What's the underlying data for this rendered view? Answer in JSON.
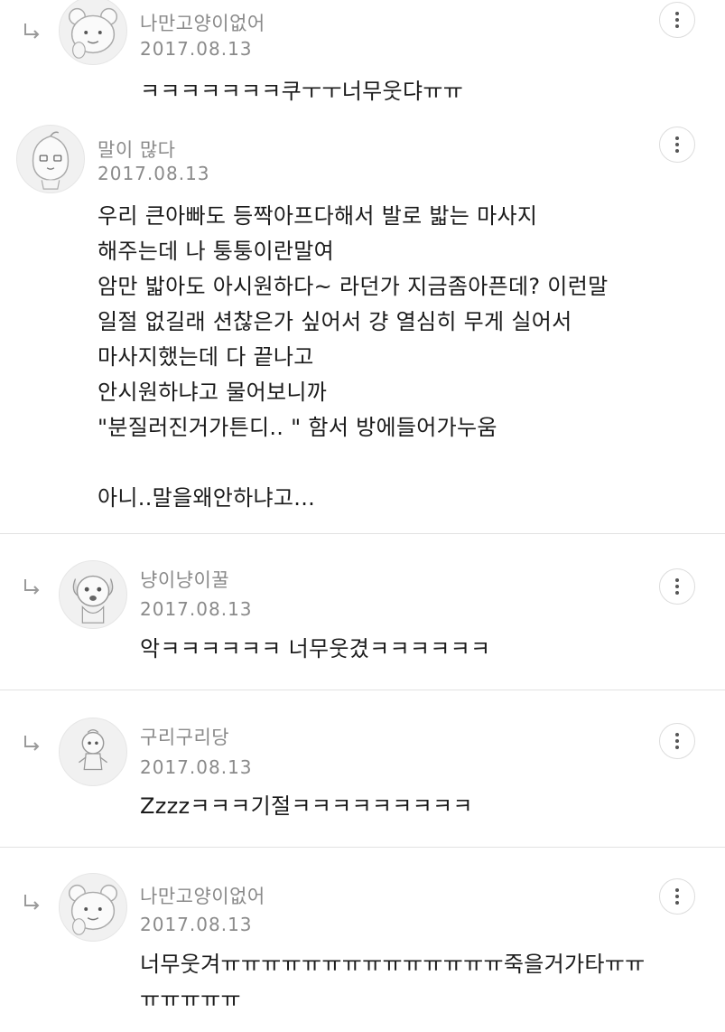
{
  "comments": [
    {
      "is_reply": true,
      "avatar_icon": "bear-character-avatar-icon",
      "nickname": "나만고양이없어",
      "date": "2017.08.13",
      "text": "ㅋㅋㅋㅋㅋㅋㅋ쿠ㅜㅜ너무웃댜ㅠㅠ"
    },
    {
      "is_reply": false,
      "avatar_icon": "peach-character-avatar-icon",
      "nickname": "말이 많다",
      "date": "2017.08.13",
      "text": "우리 큰아빠도 등짝아프다해서 발로 밟는 마사지\n해주는데 나 퉁퉁이란말여\n암만 밟아도 아시원하다~ 라던가 지금좀아픈데? 이런말\n일절 없길래 션찮은가 싶어서 걍 열심히 무게 실어서\n마사지했는데 다 끝나고\n안시원하냐고 물어보니까\n\"분질러진거가튼디.. \" 함서 방에들어가누움\n\n아니..말을왜안하냐고..."
    },
    {
      "is_reply": true,
      "avatar_icon": "dog-character-avatar-icon",
      "nickname": "냥이냥이꿀",
      "date": "2017.08.13",
      "text": "악ㅋㅋㅋㅋㅋㅋ 너무웃겼ㅋㅋㅋㅋㅋㅋ"
    },
    {
      "is_reply": true,
      "avatar_icon": "small-character-avatar-icon",
      "nickname": "구리구리당",
      "date": "2017.08.13",
      "text": "Zzzzㅋㅋㅋ기절ㅋㅋㅋㅋㅋㅋㅋㅋㅋ"
    },
    {
      "is_reply": true,
      "avatar_icon": "bear-character-avatar-icon",
      "nickname": "나만고양이없어",
      "date": "2017.08.13",
      "text": "너무웃겨ㅠㅠㅠㅠㅠㅠㅠㅠㅠㅠㅠㅠㅠㅠ죽을거가타ㅠㅠ\nㅠㅠㅠㅠㅠ"
    }
  ]
}
